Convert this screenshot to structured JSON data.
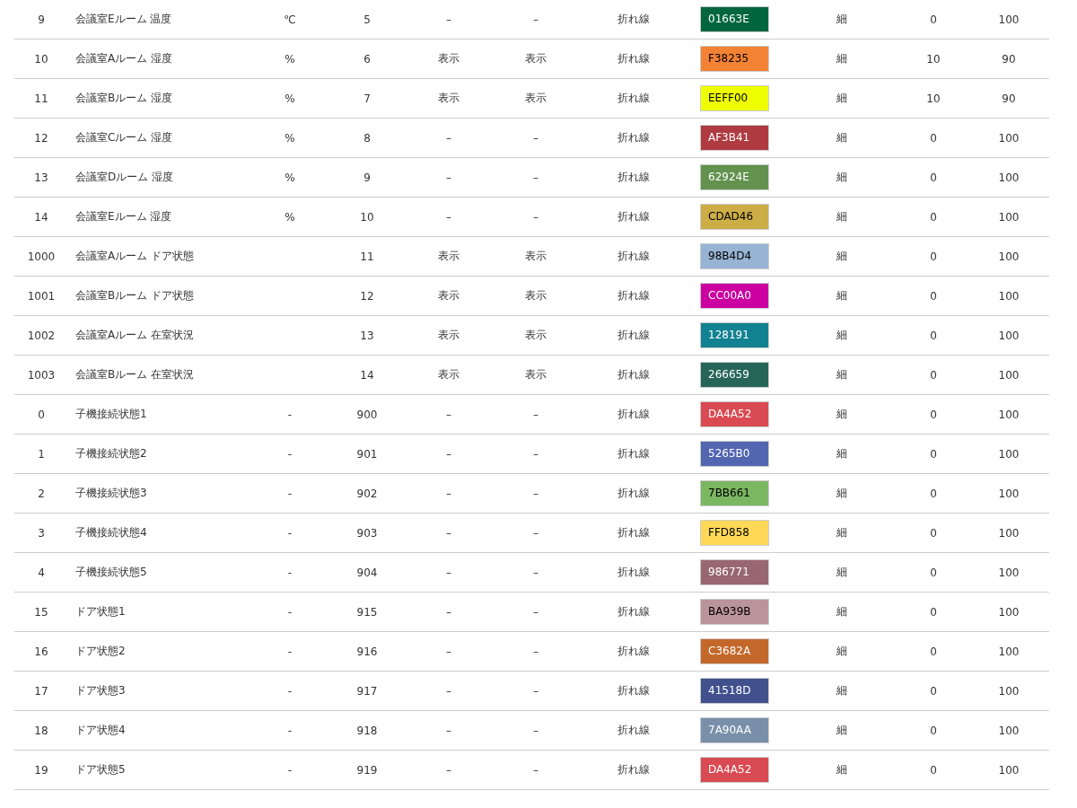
{
  "table": {
    "rows": [
      {
        "column_1": "9",
        "column_2": "会議室Eルーム 温度",
        "column_3": "℃",
        "column_4": "5",
        "column_5": "–",
        "column_6": "–",
        "column_7": "折れ線",
        "column_8": "01663E",
        "color": "#01663e",
        "column_9": "細",
        "column_10": "0",
        "column_11": "100"
      },
      {
        "column_1": "10",
        "column_2": "会議室Aルーム 湿度",
        "column_3": "%",
        "column_4": "6",
        "column_5": "表示",
        "column_6": "表示",
        "column_7": "折れ線",
        "column_8": "F38235",
        "color": "#f38235",
        "column_9": "細",
        "column_10": "10",
        "column_11": "90"
      },
      {
        "column_1": "11",
        "column_2": "会議室Bルーム 湿度",
        "column_3": "%",
        "column_4": "7",
        "column_5": "表示",
        "column_6": "表示",
        "column_7": "折れ線",
        "column_8": "EEFF00",
        "color": "#eeff00",
        "column_9": "細",
        "column_10": "10",
        "column_11": "90"
      },
      {
        "column_1": "12",
        "column_2": "会議室Cルーム 湿度",
        "column_3": "%",
        "column_4": "8",
        "column_5": "–",
        "column_6": "–",
        "column_7": "折れ線",
        "column_8": "AF3B41",
        "color": "#af3b41",
        "column_9": "細",
        "column_10": "0",
        "column_11": "100"
      },
      {
        "column_1": "13",
        "column_2": "会議室Dルーム 湿度",
        "column_3": "%",
        "column_4": "9",
        "column_5": "–",
        "column_6": "–",
        "column_7": "折れ線",
        "column_8": "62924E",
        "color": "#62924e",
        "column_9": "細",
        "column_10": "0",
        "column_11": "100"
      },
      {
        "column_1": "14",
        "column_2": "会議室Eルーム 湿度",
        "column_3": "%",
        "column_4": "10",
        "column_5": "–",
        "column_6": "–",
        "column_7": "折れ線",
        "column_8": "CDAD46",
        "color": "#cdad46",
        "column_9": "細",
        "column_10": "0",
        "column_11": "100"
      },
      {
        "column_1": "1000",
        "column_2": "会議室Aルーム ドア状態",
        "column_4": "11",
        "column_5": "表示",
        "column_6": "表示",
        "column_7": "折れ線",
        "column_8": "98B4D4",
        "color": "#98b4d4",
        "column_9": "細",
        "column_10": "0",
        "column_11": "100"
      },
      {
        "column_1": "1001",
        "column_2": "会議室Bルーム ドア状態",
        "column_4": "12",
        "column_5": "表示",
        "column_6": "表示",
        "column_7": "折れ線",
        "column_8": "CC00A0",
        "color": "#cc00a0",
        "column_9": "細",
        "column_10": "0",
        "column_11": "100"
      },
      {
        "column_1": "1002",
        "column_2": "会議室Aルーム 在室状況",
        "column_4": "13",
        "column_5": "表示",
        "column_6": "表示",
        "column_7": "折れ線",
        "column_8": "128191",
        "color": "#128191",
        "column_9": "細",
        "column_10": "0",
        "column_11": "100"
      },
      {
        "column_1": "1003",
        "column_2": "会議室Bルーム 在室状況",
        "column_4": "14",
        "column_5": "表示",
        "column_6": "表示",
        "column_7": "折れ線",
        "column_8": "266659",
        "color": "#266659",
        "column_9": "細",
        "column_10": "0",
        "column_11": "100"
      },
      {
        "column_1": "0",
        "column_2": "子機接続状態1",
        "column_3": "-",
        "column_4": "900",
        "column_5": "–",
        "column_6": "–",
        "column_7": "折れ線",
        "column_8": "DA4A52",
        "color": "#da4a52",
        "column_9": "細",
        "column_10": "0",
        "column_11": "100"
      },
      {
        "column_1": "1",
        "column_2": "子機接続状態2",
        "column_3": "-",
        "column_4": "901",
        "column_5": "–",
        "column_6": "–",
        "column_7": "折れ線",
        "column_8": "5265B0",
        "color": "#5265b0",
        "column_9": "細",
        "column_10": "0",
        "column_11": "100"
      },
      {
        "column_1": "2",
        "column_2": "子機接続状態3",
        "column_3": "-",
        "column_4": "902",
        "column_5": "–",
        "column_6": "–",
        "column_7": "折れ線",
        "column_8": "7BB661",
        "color": "#7bb661",
        "column_9": "細",
        "column_10": "0",
        "column_11": "100"
      },
      {
        "column_1": "3",
        "column_2": "子機接続状態4",
        "column_3": "-",
        "column_4": "903",
        "column_5": "–",
        "column_6": "–",
        "column_7": "折れ線",
        "column_8": "FFD858",
        "color": "#ffd858",
        "column_9": "細",
        "column_10": "0",
        "column_11": "100"
      },
      {
        "column_1": "4",
        "column_2": "子機接続状態5",
        "column_3": "-",
        "column_4": "904",
        "column_5": "–",
        "column_6": "–",
        "column_7": "折れ線",
        "column_8": "986771",
        "color": "#986771",
        "column_9": "細",
        "column_10": "0",
        "column_11": "100"
      },
      {
        "column_1": "15",
        "column_2": "ドア状態1",
        "column_3": "-",
        "column_4": "915",
        "column_5": "–",
        "column_6": "–",
        "column_7": "折れ線",
        "column_8": "BA939B",
        "color": "#ba939b",
        "column_9": "細",
        "column_10": "0",
        "column_11": "100"
      },
      {
        "column_1": "16",
        "column_2": "ドア状態2",
        "column_3": "-",
        "column_4": "916",
        "column_5": "–",
        "column_6": "–",
        "column_7": "折れ線",
        "column_8": "C3682A",
        "color": "#c3682a",
        "column_9": "細",
        "column_10": "0",
        "column_11": "100"
      },
      {
        "column_1": "17",
        "column_2": "ドア状態3",
        "column_3": "-",
        "column_4": "917",
        "column_5": "–",
        "column_6": "–",
        "column_7": "折れ線",
        "column_8": "41518D",
        "color": "#41518d",
        "column_9": "細",
        "column_10": "0",
        "column_11": "100"
      },
      {
        "column_1": "18",
        "column_2": "ドア状態4",
        "column_3": "-",
        "column_4": "918",
        "column_5": "–",
        "column_6": "–",
        "column_7": "折れ線",
        "column_8": "7A90AA",
        "color": "#7a90aa",
        "column_9": "細",
        "column_10": "0",
        "column_11": "100"
      },
      {
        "column_1": "19",
        "column_2": "ドア状態5",
        "column_3": "-",
        "column_4": "919",
        "column_5": "–",
        "column_6": "–",
        "column_7": "折れ線",
        "column_8": "DA4A52",
        "color": "#da4a52",
        "column_9": "細",
        "column_10": "0",
        "column_11": "100"
      }
    ]
  }
}
